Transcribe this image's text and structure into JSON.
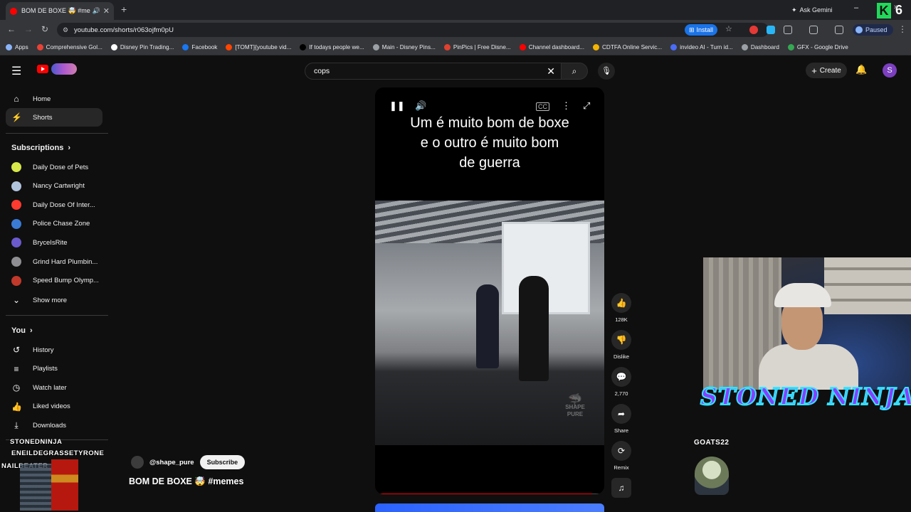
{
  "browser": {
    "tab_title": "BOM DE BOXE 🤯 #memes",
    "url": "youtube.com/shorts/r063ojfm0pU",
    "ask_gemini": "Ask Gemini",
    "install_label": "Install",
    "paused_label": "Paused",
    "bookmarks": [
      {
        "label": "Apps",
        "color": "#8ab4f8"
      },
      {
        "label": "Comprehensive Gol...",
        "color": "#e94235"
      },
      {
        "label": "Disney Pin Trading...",
        "color": "#ffffff"
      },
      {
        "label": "Facebook",
        "color": "#1877f2"
      },
      {
        "label": "[TOMT]{youtube vid...",
        "color": "#ff4500"
      },
      {
        "label": "If todays people we...",
        "color": "#000000"
      },
      {
        "label": "Main - Disney Pins...",
        "color": "#9aa0a6"
      },
      {
        "label": "PinPics | Free Disne...",
        "color": "#e0412f"
      },
      {
        "label": "Channel dashboard...",
        "color": "#ff0000"
      },
      {
        "label": "CDTFA Online Servic...",
        "color": "#f4b400"
      },
      {
        "label": "invideo AI - Turn id...",
        "color": "#4a6cf7"
      },
      {
        "label": "Dashboard",
        "color": "#9aa0a6"
      },
      {
        "label": "GFX - Google Drive",
        "color": "#34a853"
      }
    ]
  },
  "header": {
    "search_value": "cops",
    "create_label": "Create",
    "avatar_initial": "S"
  },
  "sidebar": {
    "main": [
      {
        "label": "Home",
        "icon": "⌂"
      },
      {
        "label": "Shorts",
        "icon": "⚡"
      }
    ],
    "subscriptions_title": "Subscriptions",
    "subscriptions": [
      {
        "label": "Daily Dose of Pets",
        "color": "#d6e84a"
      },
      {
        "label": "Nancy Cartwright",
        "color": "#b0c4de"
      },
      {
        "label": "Daily Dose Of Inter...",
        "color": "#ff3b30"
      },
      {
        "label": "Police Chase Zone",
        "color": "#3a7bd5"
      },
      {
        "label": "BryceIsRite",
        "color": "#6a5acd"
      },
      {
        "label": "Grind Hard Plumbin...",
        "color": "#8e8e93"
      },
      {
        "label": "Speed Bump Olymp...",
        "color": "#c0392b"
      }
    ],
    "show_more": "Show more",
    "you_title": "You",
    "you_items": [
      {
        "label": "History",
        "icon": "↺"
      },
      {
        "label": "Playlists",
        "icon": "≡"
      },
      {
        "label": "Watch later",
        "icon": "◷"
      },
      {
        "label": "Liked videos",
        "icon": "👍"
      },
      {
        "label": "Downloads",
        "icon": "⤓"
      }
    ]
  },
  "overlay": {
    "line1": "STONEDNINJA",
    "line2": "ENEILDEGRASSETYRONE",
    "line3": "NAILBEATER"
  },
  "short": {
    "caption_lines": [
      "Um é muito bom de boxe",
      "e o outro é muito bom",
      "de guerra"
    ],
    "watermark_line1": "SHAPE",
    "watermark_line2": "PURE",
    "progress": 0.96,
    "channel": "@shape_pure",
    "subscribe_label": "Subscribe",
    "title": "BOM DE BOXE 🤯 #memes"
  },
  "actions": {
    "likes": "128K",
    "dislike_label": "Dislike",
    "comments": "2,770",
    "share_label": "Share",
    "remix_label": "Remix"
  },
  "stream": {
    "name": "STONED NINJA",
    "goats_label": "GOATS22"
  },
  "colors": {
    "youtube_red": "#ff0000",
    "background": "#0f0f0f",
    "overlay_name_fill": "#8a3cff",
    "overlay_name_stroke": "#36e0ff"
  }
}
